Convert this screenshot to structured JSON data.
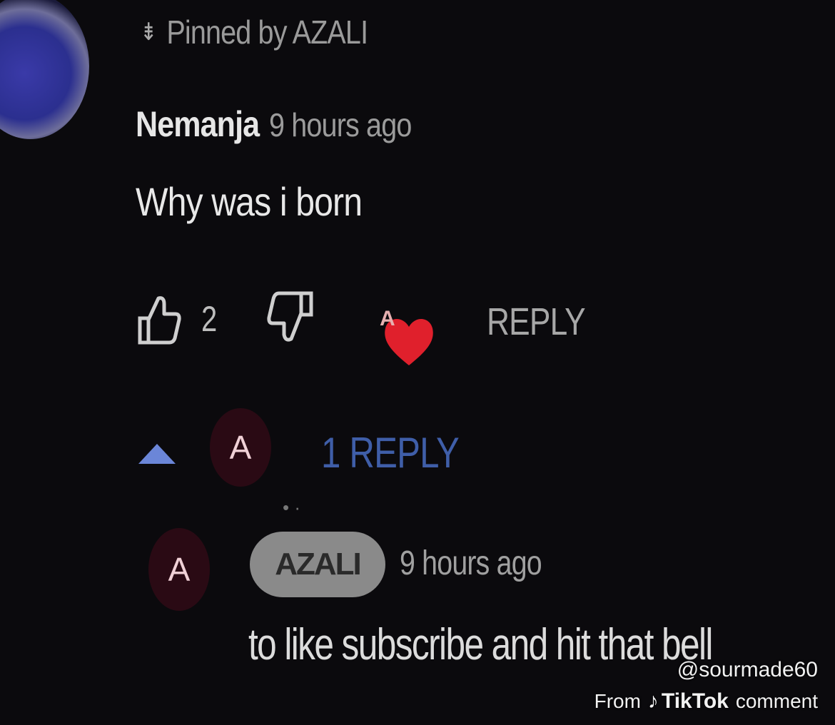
{
  "comment": {
    "pinned_label": "Pinned by AZALI",
    "author": "Nemanja",
    "time": "9 hours ago",
    "text": "Why was i born",
    "like_count": "2",
    "reply_label": "REPLY",
    "heart_avatar_letter": "A"
  },
  "replies": {
    "toggle_label": "1 REPLY",
    "avatar_letter": "A"
  },
  "reply": {
    "avatar_letter": "A",
    "author_badge": "AZALI",
    "time": "9 hours ago",
    "text": "to like subscribe and hit that bell"
  },
  "watermark": {
    "handle": "@sourmade60",
    "from": "From",
    "brand": "TikTok",
    "suffix": "comment"
  },
  "colors": {
    "background": "#0b0a0d",
    "heart": "#e0202c",
    "link_blue": "#3f5ea8",
    "badge_gray": "#8a8a8a"
  },
  "icons": [
    "pin-icon",
    "thumbs-up-icon",
    "thumbs-down-icon",
    "heart-icon",
    "caret-up-icon",
    "tiktok-note-icon"
  ]
}
